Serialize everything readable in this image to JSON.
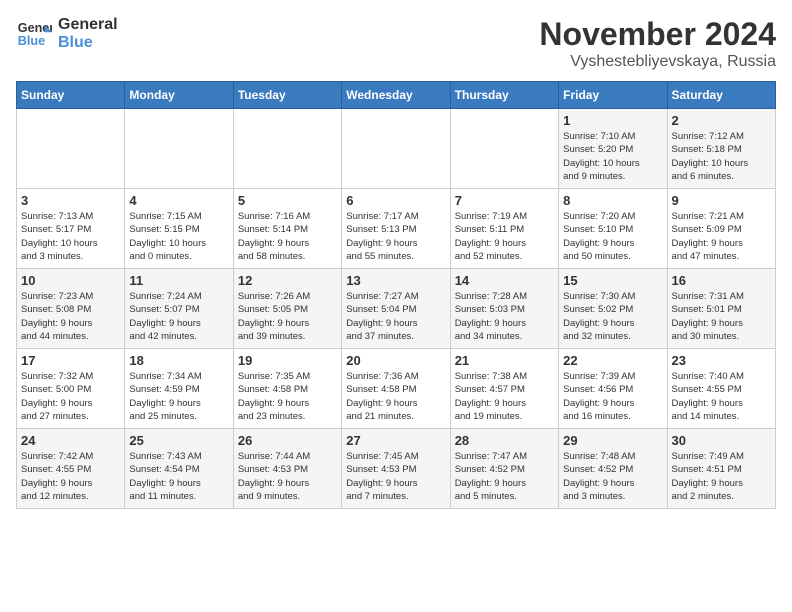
{
  "logo": {
    "line1": "General",
    "line2": "Blue"
  },
  "title": "November 2024",
  "location": "Vyshestebliyevskaya, Russia",
  "days_of_week": [
    "Sunday",
    "Monday",
    "Tuesday",
    "Wednesday",
    "Thursday",
    "Friday",
    "Saturday"
  ],
  "weeks": [
    [
      {
        "day": "",
        "info": ""
      },
      {
        "day": "",
        "info": ""
      },
      {
        "day": "",
        "info": ""
      },
      {
        "day": "",
        "info": ""
      },
      {
        "day": "",
        "info": ""
      },
      {
        "day": "1",
        "info": "Sunrise: 7:10 AM\nSunset: 5:20 PM\nDaylight: 10 hours\nand 9 minutes."
      },
      {
        "day": "2",
        "info": "Sunrise: 7:12 AM\nSunset: 5:18 PM\nDaylight: 10 hours\nand 6 minutes."
      }
    ],
    [
      {
        "day": "3",
        "info": "Sunrise: 7:13 AM\nSunset: 5:17 PM\nDaylight: 10 hours\nand 3 minutes."
      },
      {
        "day": "4",
        "info": "Sunrise: 7:15 AM\nSunset: 5:15 PM\nDaylight: 10 hours\nand 0 minutes."
      },
      {
        "day": "5",
        "info": "Sunrise: 7:16 AM\nSunset: 5:14 PM\nDaylight: 9 hours\nand 58 minutes."
      },
      {
        "day": "6",
        "info": "Sunrise: 7:17 AM\nSunset: 5:13 PM\nDaylight: 9 hours\nand 55 minutes."
      },
      {
        "day": "7",
        "info": "Sunrise: 7:19 AM\nSunset: 5:11 PM\nDaylight: 9 hours\nand 52 minutes."
      },
      {
        "day": "8",
        "info": "Sunrise: 7:20 AM\nSunset: 5:10 PM\nDaylight: 9 hours\nand 50 minutes."
      },
      {
        "day": "9",
        "info": "Sunrise: 7:21 AM\nSunset: 5:09 PM\nDaylight: 9 hours\nand 47 minutes."
      }
    ],
    [
      {
        "day": "10",
        "info": "Sunrise: 7:23 AM\nSunset: 5:08 PM\nDaylight: 9 hours\nand 44 minutes."
      },
      {
        "day": "11",
        "info": "Sunrise: 7:24 AM\nSunset: 5:07 PM\nDaylight: 9 hours\nand 42 minutes."
      },
      {
        "day": "12",
        "info": "Sunrise: 7:26 AM\nSunset: 5:05 PM\nDaylight: 9 hours\nand 39 minutes."
      },
      {
        "day": "13",
        "info": "Sunrise: 7:27 AM\nSunset: 5:04 PM\nDaylight: 9 hours\nand 37 minutes."
      },
      {
        "day": "14",
        "info": "Sunrise: 7:28 AM\nSunset: 5:03 PM\nDaylight: 9 hours\nand 34 minutes."
      },
      {
        "day": "15",
        "info": "Sunrise: 7:30 AM\nSunset: 5:02 PM\nDaylight: 9 hours\nand 32 minutes."
      },
      {
        "day": "16",
        "info": "Sunrise: 7:31 AM\nSunset: 5:01 PM\nDaylight: 9 hours\nand 30 minutes."
      }
    ],
    [
      {
        "day": "17",
        "info": "Sunrise: 7:32 AM\nSunset: 5:00 PM\nDaylight: 9 hours\nand 27 minutes."
      },
      {
        "day": "18",
        "info": "Sunrise: 7:34 AM\nSunset: 4:59 PM\nDaylight: 9 hours\nand 25 minutes."
      },
      {
        "day": "19",
        "info": "Sunrise: 7:35 AM\nSunset: 4:58 PM\nDaylight: 9 hours\nand 23 minutes."
      },
      {
        "day": "20",
        "info": "Sunrise: 7:36 AM\nSunset: 4:58 PM\nDaylight: 9 hours\nand 21 minutes."
      },
      {
        "day": "21",
        "info": "Sunrise: 7:38 AM\nSunset: 4:57 PM\nDaylight: 9 hours\nand 19 minutes."
      },
      {
        "day": "22",
        "info": "Sunrise: 7:39 AM\nSunset: 4:56 PM\nDaylight: 9 hours\nand 16 minutes."
      },
      {
        "day": "23",
        "info": "Sunrise: 7:40 AM\nSunset: 4:55 PM\nDaylight: 9 hours\nand 14 minutes."
      }
    ],
    [
      {
        "day": "24",
        "info": "Sunrise: 7:42 AM\nSunset: 4:55 PM\nDaylight: 9 hours\nand 12 minutes."
      },
      {
        "day": "25",
        "info": "Sunrise: 7:43 AM\nSunset: 4:54 PM\nDaylight: 9 hours\nand 11 minutes."
      },
      {
        "day": "26",
        "info": "Sunrise: 7:44 AM\nSunset: 4:53 PM\nDaylight: 9 hours\nand 9 minutes."
      },
      {
        "day": "27",
        "info": "Sunrise: 7:45 AM\nSunset: 4:53 PM\nDaylight: 9 hours\nand 7 minutes."
      },
      {
        "day": "28",
        "info": "Sunrise: 7:47 AM\nSunset: 4:52 PM\nDaylight: 9 hours\nand 5 minutes."
      },
      {
        "day": "29",
        "info": "Sunrise: 7:48 AM\nSunset: 4:52 PM\nDaylight: 9 hours\nand 3 minutes."
      },
      {
        "day": "30",
        "info": "Sunrise: 7:49 AM\nSunset: 4:51 PM\nDaylight: 9 hours\nand 2 minutes."
      }
    ]
  ]
}
